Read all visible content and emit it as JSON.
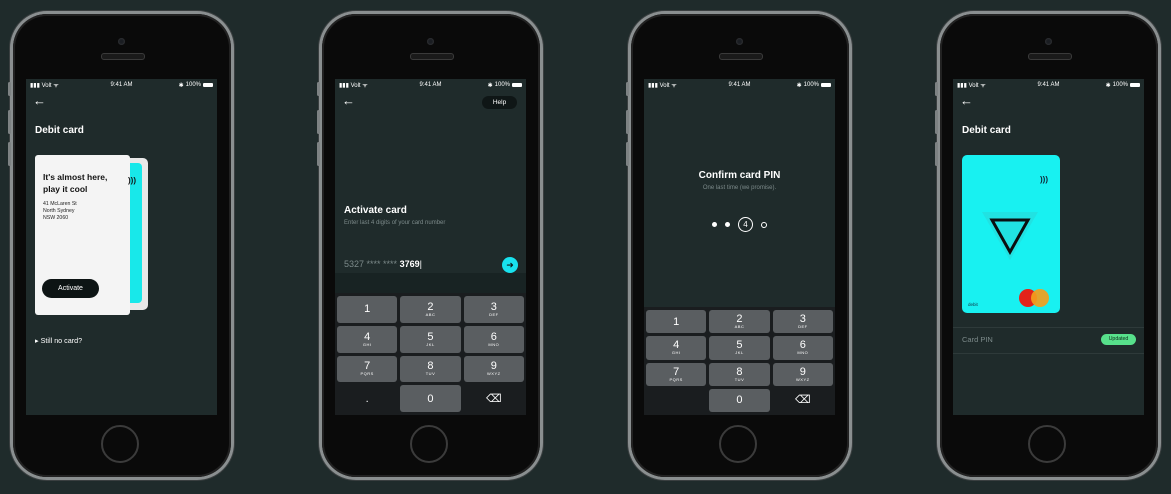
{
  "status": {
    "carrier": "Volt",
    "time": "9:41 AM",
    "battery": "100%"
  },
  "screen1": {
    "title": "Debit card",
    "envelope_heading": "It's almost here, play it cool",
    "address": [
      "41 McLaren St",
      "North Sydney",
      "NSW 2060"
    ],
    "activate_label": "Activate",
    "still_no_card": "Still no card?"
  },
  "screen2": {
    "help_label": "Help",
    "title": "Activate card",
    "subtitle": "Enter last 4 digits of your card number",
    "masked_prefix": "5327 **** ****",
    "entered_digits": "3769",
    "keys": [
      {
        "num": "1",
        "sub": ""
      },
      {
        "num": "2",
        "sub": "ABC"
      },
      {
        "num": "3",
        "sub": "DEF"
      },
      {
        "num": "4",
        "sub": "GHI"
      },
      {
        "num": "5",
        "sub": "JKL"
      },
      {
        "num": "6",
        "sub": "MNO"
      },
      {
        "num": "7",
        "sub": "PQRS"
      },
      {
        "num": "8",
        "sub": "TUV"
      },
      {
        "num": "9",
        "sub": "WXYZ"
      },
      {
        "num": ".",
        "sub": ""
      },
      {
        "num": "0",
        "sub": ""
      },
      {
        "num": "⌫",
        "sub": ""
      }
    ]
  },
  "screen3": {
    "title": "Confirm card PIN",
    "subtitle": "One last time (we promise).",
    "current_digit": "4"
  },
  "screen4": {
    "title": "Debit card",
    "card_label": "debit",
    "pin_label": "Card PIN",
    "badge": "Updated"
  },
  "colors": {
    "background": "#1f2b2b",
    "accent": "#18e2ee",
    "success": "#57e08b"
  }
}
